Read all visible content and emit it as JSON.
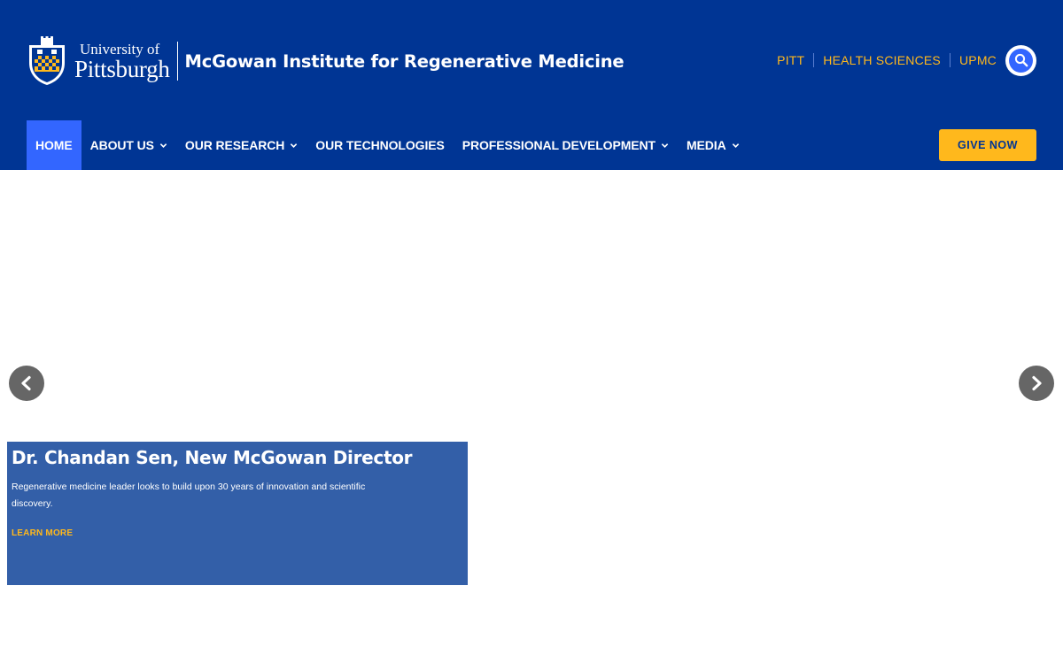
{
  "header": {
    "logo": {
      "university_line1": "University of",
      "university_line2": "Pittsburgh",
      "institute": "McGowan Institute for Regenerative Medicine"
    },
    "utility_links": [
      {
        "label": "PITT"
      },
      {
        "label": "HEALTH SCIENCES"
      },
      {
        "label": "UPMC"
      }
    ],
    "search_icon": "search-icon"
  },
  "nav": {
    "items": [
      {
        "label": "HOME",
        "active": true,
        "dropdown": false
      },
      {
        "label": "ABOUT US",
        "active": false,
        "dropdown": true
      },
      {
        "label": "OUR RESEARCH",
        "active": false,
        "dropdown": true
      },
      {
        "label": "OUR TECHNOLOGIES",
        "active": false,
        "dropdown": false
      },
      {
        "label": "PROFESSIONAL DEVELOPMENT",
        "active": false,
        "dropdown": true
      },
      {
        "label": "MEDIA",
        "active": false,
        "dropdown": true
      }
    ],
    "give_label": "GIVE NOW"
  },
  "slide": {
    "title": "Dr. Chandan Sen, New McGowan Director",
    "text": "Regenerative medicine leader looks to build upon 30 years of innovation and scientific discovery.",
    "link_label": "LEARN MORE"
  },
  "colors": {
    "header_bg": "#003594",
    "accent_gold": "#ffb81c",
    "active_blue": "#3366ff",
    "caption_bg": "#335fa8"
  }
}
